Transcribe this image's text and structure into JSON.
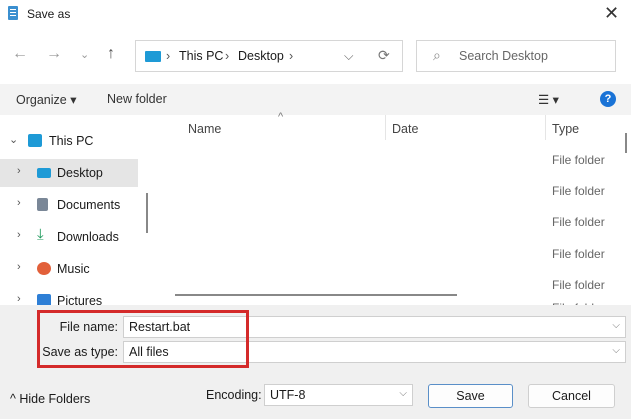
{
  "window": {
    "title": "Save as",
    "close": "✕"
  },
  "nav": {
    "back": "←",
    "forward": "→",
    "recent": "⌄",
    "up": "↑",
    "breadcrumb": [
      "This PC",
      "Desktop"
    ],
    "sep": "›",
    "dropdown": "⌵",
    "refresh": "⟳",
    "search_placeholder": "Search Desktop",
    "search_icon": "⌕"
  },
  "toolbar": {
    "organize": "Organize ▾",
    "new_folder": "New folder",
    "view": "☰ ▾",
    "help": "?"
  },
  "sidebar": {
    "items": [
      {
        "label": "This PC",
        "chev": "⌄",
        "color": "#1e9ad6"
      },
      {
        "label": "Desktop",
        "chev": "›",
        "color": "#1e9ad6"
      },
      {
        "label": "Documents",
        "chev": "›",
        "color": "#7a8797"
      },
      {
        "label": "Downloads",
        "chev": "›",
        "color": "#1f9a5c"
      },
      {
        "label": "Music",
        "chev": "›",
        "color": "#e2603a"
      },
      {
        "label": "Pictures",
        "chev": "›",
        "color": "#2e7fd6"
      }
    ]
  },
  "list": {
    "columns": [
      "Name",
      "Date",
      "Type"
    ],
    "sort": "^",
    "rows": [
      "File folder",
      "File folder",
      "File folder",
      "File folder",
      "File folder",
      "File folder"
    ]
  },
  "form": {
    "file_name_label": "File name:",
    "file_name": "Restart.bat",
    "type_label": "Save as type:",
    "type": "All files",
    "dd": "⌵"
  },
  "footer": {
    "hide_folders": "^  Hide Folders",
    "encoding_label": "Encoding:",
    "encoding": "UTF-8",
    "save": "Save",
    "cancel": "Cancel"
  },
  "highlight_color": "#d42a2a"
}
